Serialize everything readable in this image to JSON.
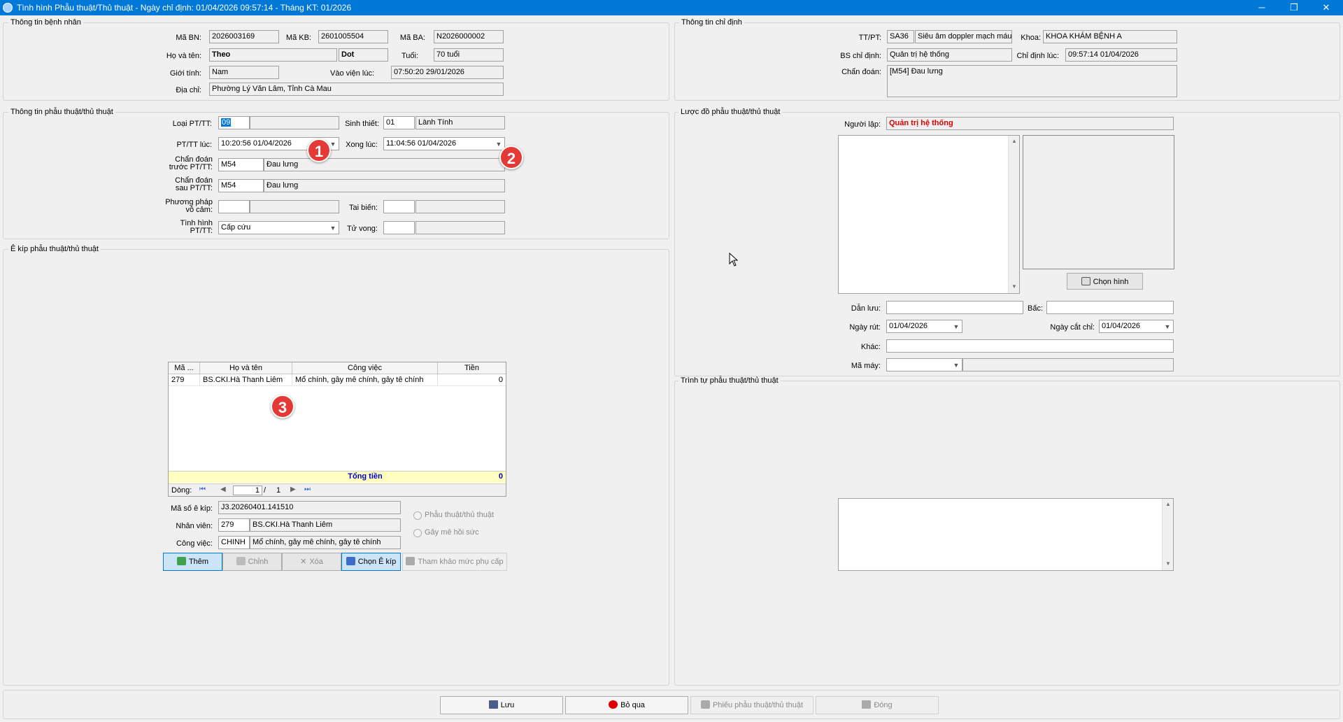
{
  "window": {
    "title": "Tình hình Phẫu thuật/Thủ thuật - Ngày chỉ định: 01/04/2026 09:57:14 - Tháng KT: 01/2026",
    "minimize": "─",
    "restore": "❐",
    "close": "✕"
  },
  "patient": {
    "group": "Thông tin bệnh nhân",
    "ma_bn_label": "Mã BN:",
    "ma_bn": "2026003169",
    "ma_kb_label": "Mã KB:",
    "ma_kb": "2601005504",
    "ma_ba_label": "Mã BA:",
    "ma_ba": "N2026000002",
    "ho_ten_label": "Họ và tên:",
    "ho": "Theo",
    "ten": "Dot",
    "tuoi_label": "Tuổi:",
    "tuoi": "70 tuổi",
    "gioi_tinh_label": "Giới tính:",
    "gioi_tinh": "Nam",
    "vao_vien_label": "Vào viện lúc:",
    "vao_vien": "07:50:20 29/01/2026",
    "dia_chi_label": "Địa chỉ:",
    "dia_chi": "Phường Lý Văn Lâm, Tỉnh Cà Mau"
  },
  "order": {
    "group": "Thông tin chỉ định",
    "tt_pt_label": "TT/PT:",
    "tt_pt_code": "SA36",
    "tt_pt_name": "Siêu âm doppler mạch máu",
    "khoa_label": "Khoa:",
    "khoa": "KHOA KHÁM BỆNH A",
    "bs_label": "BS chỉ định:",
    "bs": "Quản trị hệ thống",
    "chi_dinh_label": "Chỉ định lúc:",
    "chi_dinh": "09:57:14 01/04/2026",
    "chan_doan_label": "Chẩn đoán:",
    "chan_doan": "[M54] Đau lưng"
  },
  "surgery": {
    "group": "Thông tin phẫu thuật/thủ thuật",
    "loai_label": "Loại PT/TT:",
    "loai": "09",
    "sinh_thiet_label": "Sinh thiết:",
    "sinh_thiet_code": "01",
    "sinh_thiet": "Lành Tính",
    "pt_luc_label": "PT/TT lúc:",
    "pt_luc": "10:20:56 01/04/2026",
    "xong_label": "Xong lúc:",
    "xong": "11:04:56 01/04/2026",
    "cd_truoc_label_1": "Chẩn đoán",
    "cd_truoc_label_2": "trước PT/TT:",
    "cd_truoc_code": "M54",
    "cd_truoc": "Đau lưng",
    "cd_sau_label_1": "Chẩn đoán",
    "cd_sau_label_2": "sau PT/TT:",
    "cd_sau_code": "M54",
    "cd_sau": "Đau lưng",
    "vo_cam_label_1": "Phương pháp",
    "vo_cam_label_2": "vô cảm:",
    "tai_bien_label": "Tai biến:",
    "tinh_hinh_label_1": "Tình hình",
    "tinh_hinh_label_2": "PT/TT:",
    "tinh_hinh": "Cấp cứu",
    "tu_vong_label": "Tử vong:"
  },
  "team": {
    "group": "Ê kíp phẫu thuật/thủ thuật",
    "columns": [
      "Mã ...",
      "Họ và tên",
      "Công việc",
      "Tiền"
    ],
    "rows": [
      {
        "ma": "279",
        "ho_ten": "BS.CKI.Hà Thanh Liêm",
        "cong_viec": "Mổ chính, gây mê chính, gây tê chính",
        "tien": "0"
      }
    ],
    "total_label": "Tổng tiền",
    "total": "0",
    "pager_label": "Dòng:",
    "page": "1",
    "page_sep": "/",
    "page_total": "1",
    "ma_ekip_label": "Mã số ê kíp:",
    "ma_ekip": "J3.20260401.141510",
    "nhan_vien_label": "Nhân viên:",
    "nhan_vien_code": "279",
    "nhan_vien": "BS.CKI.Hà Thanh Liêm",
    "cong_viec_label": "Công việc:",
    "cong_viec_code": "CHINH",
    "cong_viec": "Mổ chính, gây mê chính, gây tê chính",
    "radio1": "Phẫu thuật/thủ thuật",
    "radio2": "Gây mê hồi sức",
    "btn_them": "Thêm",
    "btn_chinh": "Chỉnh",
    "btn_xoa": "Xóa",
    "btn_chon": "Chọn Ê kíp",
    "btn_tham_khao": "Tham khảo mức phụ cấp"
  },
  "diagram": {
    "group": "Lược đồ phẫu thuật/thủ thuật",
    "nguoi_lap_label": "Người lập:",
    "nguoi_lap": "Quản trị hệ thống",
    "chon_hinh": "Chọn hình",
    "dan_luu_label": "Dẫn lưu:",
    "bac_label": "Bấc:",
    "ngay_rut_label": "Ngày rút:",
    "ngay_rut": "01/04/2026",
    "ngay_cat_chi_label": "Ngày cắt chỉ:",
    "ngay_cat_chi": "01/04/2026",
    "khac_label": "Khác:",
    "ma_may_label": "Mã máy:"
  },
  "sequence": {
    "group": "Trình tự phẫu thuật/thủ thuật"
  },
  "footer": {
    "btn_luu": "Lưu",
    "btn_bo_qua": "Bỏ qua",
    "btn_phieu": "Phiếu phẫu thuật/thủ thuật",
    "btn_dong": "Đóng"
  },
  "markers": [
    "1",
    "2",
    "3"
  ],
  "colors": {
    "titlebar": "#0078d7",
    "required_red": "#e00000",
    "total_row": "#ffffc0",
    "marker": "#e53935"
  }
}
